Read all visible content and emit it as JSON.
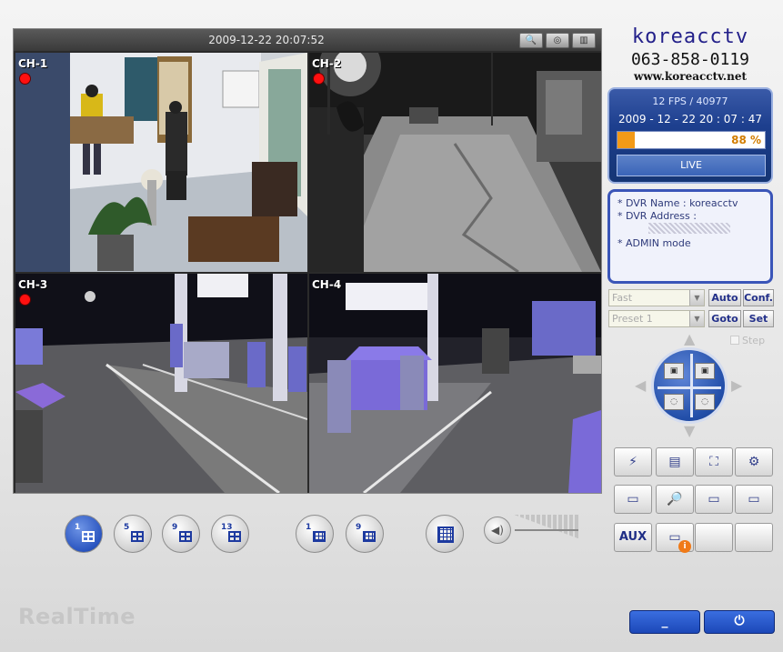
{
  "video": {
    "timestamp": "2009-12-22 20:07:52",
    "channels": [
      {
        "label": "CH-1",
        "recording": true
      },
      {
        "label": "CH-2",
        "recording": true
      },
      {
        "label": "CH-3",
        "recording": true
      },
      {
        "label": "CH-4",
        "recording": false
      }
    ]
  },
  "brand": {
    "name": "koreacctv",
    "phone": "063-858-0119",
    "url": "www.koreacctv.net"
  },
  "status": {
    "fps": "12 FPS / 40977",
    "datetime": "2009 - 12 - 22  20 : 07 : 47",
    "progress_percent": 88,
    "progress_label": "88 %",
    "live_label": "LIVE"
  },
  "info": {
    "dvr_name": "* DVR Name : koreacctv",
    "dvr_address": "* DVR Address :",
    "mode": "* ADMIN mode"
  },
  "ptz": {
    "speed_value": "Fast",
    "preset_value": "Preset 1",
    "auto_label": "Auto",
    "conf_label": "Conf.",
    "goto_label": "Goto",
    "set_label": "Set",
    "step_label": "Step"
  },
  "tools": {
    "aux_label": "AUX"
  },
  "splits": [
    {
      "num": "1"
    },
    {
      "num": "5"
    },
    {
      "num": "9"
    },
    {
      "num": "13"
    },
    {
      "num": "1"
    },
    {
      "num": "9"
    }
  ],
  "footer": {
    "brand": "RealTime",
    "minimize_label": "_",
    "power_label": "⏻"
  },
  "colors": {
    "accent": "#1c48b8",
    "progress": "#f39a17",
    "rec": "#ff1010"
  }
}
